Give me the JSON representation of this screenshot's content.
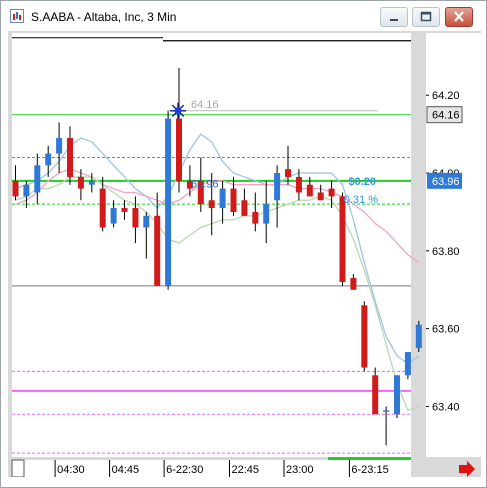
{
  "window": {
    "title": "S.AABA - Altaba, Inc, 3 Min",
    "minimize_icon": "minimize-icon",
    "maximize_icon": "maximize-icon",
    "close_icon": "close-icon"
  },
  "colors": {
    "up": "#2f79d6",
    "down": "#d11a1a",
    "green_line": "#22cc22",
    "pink_line": "#ee66ee",
    "ma_fast": "#9cc4e8",
    "ma_pink": "#f3a2c8",
    "ma_green": "#b8d8b0",
    "scroll_arrow": "#e01010"
  },
  "chart_data": {
    "type": "candlestick",
    "y_axis": {
      "range": [
        63.27,
        64.36
      ],
      "ticks": [
        "64.20",
        "64.00",
        "63.80",
        "63.60",
        "63.40"
      ],
      "tick_values": [
        64.2,
        64.0,
        63.8,
        63.6,
        63.4
      ],
      "current_price_label": "64.16",
      "last_price_label": "63.96"
    },
    "x_axis": {
      "ticks": [
        "04:30",
        "04:45",
        "6-22:30",
        "22:45",
        "23:00",
        "6-23:15"
      ],
      "tick_bar_index": [
        4,
        9,
        14,
        20,
        25,
        31
      ]
    },
    "annotations": {
      "high_label": "64.16",
      "low_label": "63.96",
      "change_label": "$0.20",
      "change_pct_label": "0.31 %"
    },
    "reference_lines": {
      "black_top": 64.34,
      "green": [
        64.15,
        64.04,
        63.98,
        63.92
      ],
      "gray": 63.71,
      "pink": [
        63.49,
        63.44,
        63.38,
        63.28
      ]
    },
    "candles": [
      {
        "o": 63.98,
        "h": 64.02,
        "l": 63.93,
        "c": 63.94
      },
      {
        "o": 63.94,
        "h": 63.98,
        "l": 63.91,
        "c": 63.97
      },
      {
        "o": 63.95,
        "h": 64.05,
        "l": 63.92,
        "c": 64.02
      },
      {
        "o": 64.02,
        "h": 64.07,
        "l": 63.99,
        "c": 64.05
      },
      {
        "o": 64.05,
        "h": 64.13,
        "l": 64.0,
        "c": 64.09
      },
      {
        "o": 64.09,
        "h": 64.12,
        "l": 63.97,
        "c": 63.99
      },
      {
        "o": 63.99,
        "h": 64.01,
        "l": 63.93,
        "c": 63.96
      },
      {
        "o": 63.97,
        "h": 64.0,
        "l": 63.95,
        "c": 63.98
      },
      {
        "o": 63.96,
        "h": 63.99,
        "l": 63.85,
        "c": 63.86
      },
      {
        "o": 63.87,
        "h": 63.93,
        "l": 63.86,
        "c": 63.91
      },
      {
        "o": 63.91,
        "h": 63.93,
        "l": 63.88,
        "c": 63.9
      },
      {
        "o": 63.91,
        "h": 63.94,
        "l": 63.82,
        "c": 63.86
      },
      {
        "o": 63.86,
        "h": 63.9,
        "l": 63.78,
        "c": 63.89
      },
      {
        "o": 63.89,
        "h": 63.95,
        "l": 63.71,
        "c": 63.71
      },
      {
        "o": 63.71,
        "h": 64.16,
        "l": 63.7,
        "c": 64.14
      },
      {
        "o": 64.14,
        "h": 64.27,
        "l": 63.95,
        "c": 63.98
      },
      {
        "o": 63.98,
        "h": 64.02,
        "l": 63.94,
        "c": 63.96
      },
      {
        "o": 63.98,
        "h": 64.04,
        "l": 63.9,
        "c": 63.92
      },
      {
        "o": 63.93,
        "h": 64.0,
        "l": 63.84,
        "c": 63.91
      },
      {
        "o": 63.91,
        "h": 63.98,
        "l": 63.87,
        "c": 63.96
      },
      {
        "o": 63.96,
        "h": 63.99,
        "l": 63.89,
        "c": 63.9
      },
      {
        "o": 63.93,
        "h": 63.96,
        "l": 63.89,
        "c": 63.89
      },
      {
        "o": 63.9,
        "h": 63.95,
        "l": 63.85,
        "c": 63.87
      },
      {
        "o": 63.87,
        "h": 63.98,
        "l": 63.82,
        "c": 63.92
      },
      {
        "o": 63.93,
        "h": 64.02,
        "l": 63.86,
        "c": 64.0
      },
      {
        "o": 64.01,
        "h": 64.07,
        "l": 63.97,
        "c": 63.99
      },
      {
        "o": 63.99,
        "h": 64.01,
        "l": 63.93,
        "c": 63.95
      },
      {
        "o": 63.97,
        "h": 63.99,
        "l": 63.94,
        "c": 63.94
      },
      {
        "o": 63.95,
        "h": 63.97,
        "l": 63.93,
        "c": 63.93
      },
      {
        "o": 63.96,
        "h": 63.98,
        "l": 63.91,
        "c": 63.94
      },
      {
        "o": 63.94,
        "h": 63.95,
        "l": 63.71,
        "c": 63.72
      },
      {
        "o": 63.73,
        "h": 63.74,
        "l": 63.7,
        "c": 63.7
      },
      {
        "o": 63.66,
        "h": 63.67,
        "l": 63.49,
        "c": 63.5
      },
      {
        "o": 63.48,
        "h": 63.5,
        "l": 63.39,
        "c": 63.38
      },
      {
        "o": 63.39,
        "h": 63.4,
        "l": 63.3,
        "c": 63.39
      },
      {
        "o": 63.38,
        "h": 63.48,
        "l": 63.37,
        "c": 63.48
      },
      {
        "o": 63.48,
        "h": 63.54,
        "l": 63.47,
        "c": 63.54
      },
      {
        "o": 63.55,
        "h": 63.62,
        "l": 63.54,
        "c": 63.61
      }
    ],
    "moving_averages": [
      {
        "color_key": "ma_fast",
        "values": [
          63.96,
          63.97,
          63.98,
          64.0,
          64.03,
          64.07,
          64.09,
          64.08,
          64.05,
          64.02,
          63.99,
          63.96,
          63.94,
          63.91,
          63.94,
          64.0,
          64.06,
          64.1,
          64.08,
          64.03,
          64.0,
          63.99,
          63.98,
          63.97,
          63.97,
          63.99,
          64.0,
          64.0,
          64.0,
          64.0,
          63.97,
          63.88,
          63.77,
          63.67,
          63.58,
          63.53,
          63.51,
          63.53
        ]
      },
      {
        "color_key": "ma_pink",
        "values": [
          63.92,
          63.93,
          63.95,
          63.98,
          64.0,
          64.01,
          64.0,
          63.99,
          63.97,
          63.96,
          63.95,
          63.95,
          63.94,
          63.93,
          63.92,
          63.93,
          63.95,
          63.97,
          63.98,
          63.98,
          63.97,
          63.97,
          63.97,
          63.97,
          63.97,
          63.97,
          63.96,
          63.96,
          63.96,
          63.95,
          63.94,
          63.92,
          63.9,
          63.87,
          63.85,
          63.82,
          63.79,
          63.77
        ]
      },
      {
        "color_key": "ma_green",
        "values": [
          63.93,
          63.94,
          63.96,
          63.96,
          63.97,
          63.99,
          63.99,
          63.99,
          63.97,
          63.95,
          63.93,
          63.92,
          63.9,
          63.87,
          63.83,
          63.82,
          63.84,
          63.86,
          63.87,
          63.88,
          63.88,
          63.89,
          63.89,
          63.9,
          63.91,
          63.92,
          63.93,
          63.93,
          63.94,
          63.93,
          63.89,
          63.83,
          63.75,
          63.66,
          63.56,
          63.46,
          63.39,
          63.4
        ]
      }
    ]
  }
}
